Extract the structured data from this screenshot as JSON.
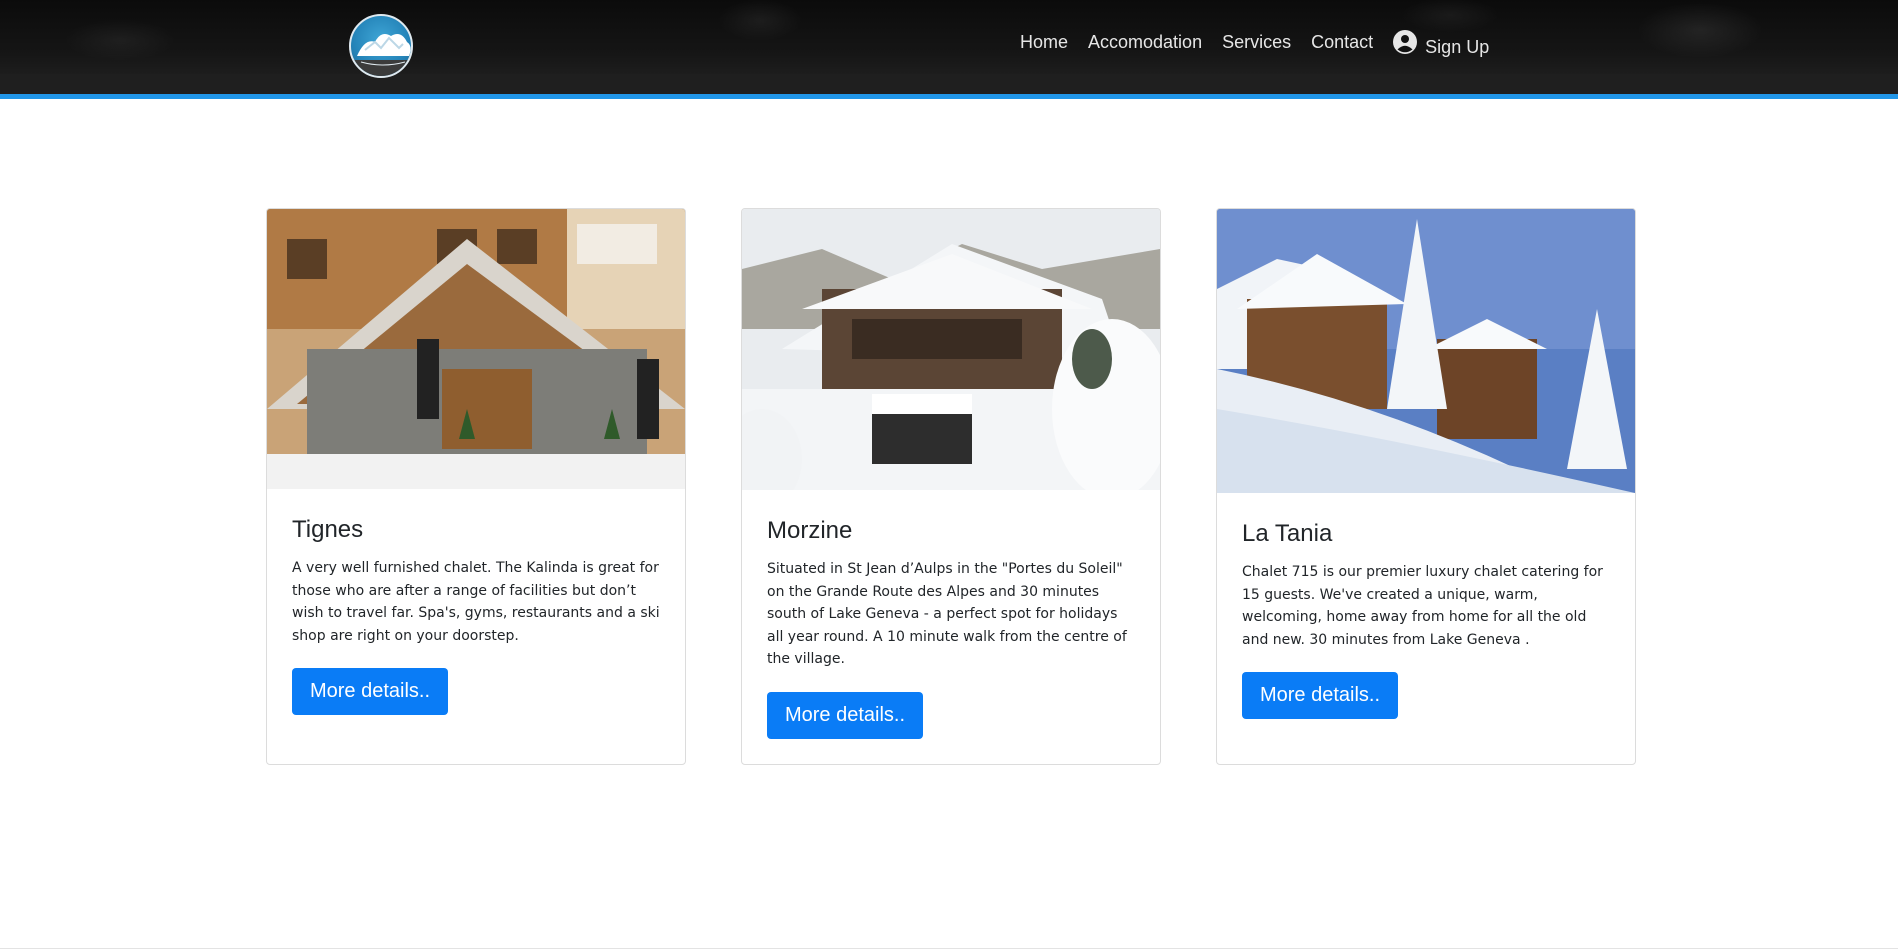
{
  "nav": {
    "links": [
      "Home",
      "Accomodation",
      "Services",
      "Contact"
    ],
    "signup_label": "Sign Up"
  },
  "cards": [
    {
      "title": "Tignes",
      "description": "A very well furnished chalet. The Kalinda is great for those who are after a range of facilities but don’t wish to travel far. Spa's, gyms, restaurants and a ski shop are right on your doorstep.",
      "button": "More details.."
    },
    {
      "title": "Morzine",
      "description": "Situated in St Jean d’Aulps in the \"Portes du Soleil\" on the Grande Route des Alpes and 30 minutes south of Lake Geneva - a perfect spot for holidays all year round. A 10 minute walk from the centre of the village.",
      "button": "More details.."
    },
    {
      "title": "La Tania",
      "description": "Chalet 715 is our premier luxury chalet catering for 15 guests. We've created a unique, warm, welcoming, home away from home for all the old and new. 30 minutes from Lake Geneva .",
      "button": "More details.."
    }
  ],
  "colors": {
    "accent": "#2196e8",
    "button": "#0a7cf6",
    "navbar": "#111111"
  }
}
